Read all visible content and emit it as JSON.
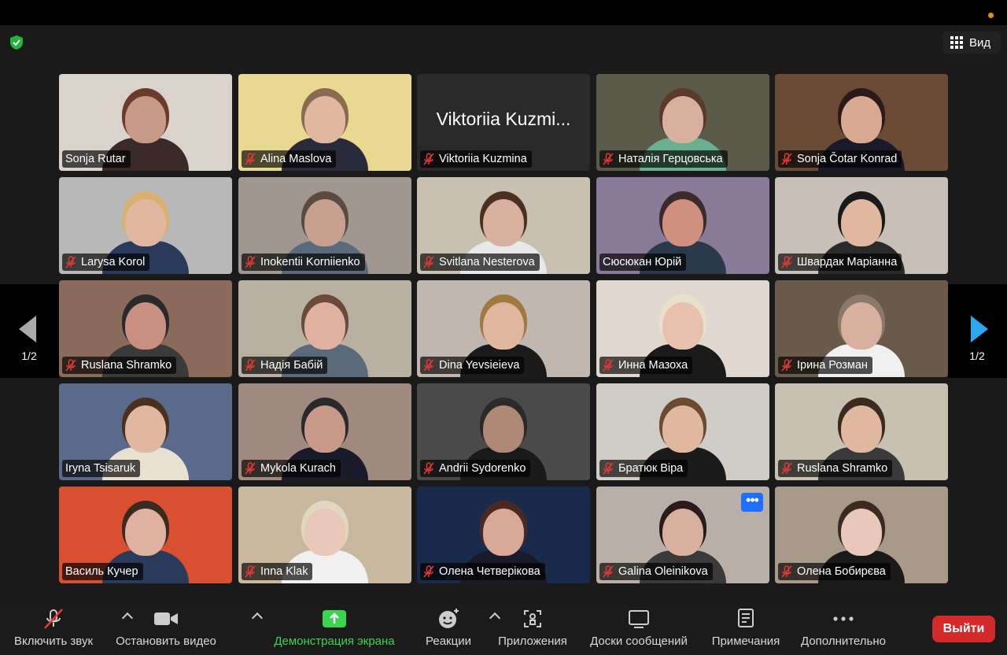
{
  "header": {
    "view_label": "Вид"
  },
  "pagination": {
    "left_page": "1/2",
    "right_page": "1/2"
  },
  "participants": [
    {
      "name": "Sonja Rutar",
      "muted": false,
      "active": true,
      "bg": "#d9d3cc",
      "skin": "#c79a85",
      "hair": "#6b3a2a",
      "shirt": "#3a2a2a"
    },
    {
      "name": "Alina Maslova",
      "muted": true,
      "bg": "#e8d890",
      "skin": "#e0b8a0",
      "hair": "#8a6a50",
      "shirt": "#2a2a3a"
    },
    {
      "name": "Viktoriia Kuzmina",
      "display_name": "Viktoriia Kuzmi...",
      "muted": true,
      "no_video": true
    },
    {
      "name": "Наталія Герцовська",
      "muted": true,
      "bg": "#5a5a4a",
      "skin": "#d8b0a0",
      "hair": "#5a3a2a",
      "shirt": "#6ab090"
    },
    {
      "name": "Sonja Čotar Konrad",
      "muted": true,
      "bg": "#6b4a35",
      "skin": "#d8a890",
      "hair": "#2a1a1a",
      "shirt": "#1a1a2a"
    },
    {
      "name": "Larysa Korol",
      "muted": true,
      "bg": "#b8b8b8",
      "skin": "#e0b8a0",
      "hair": "#d8b070",
      "shirt": "#2a3a5a"
    },
    {
      "name": "Inokentii Korniienko",
      "muted": true,
      "bg": "#a09890",
      "skin": "#c8a090",
      "hair": "#5a4a40",
      "shirt": "#5a6a7a"
    },
    {
      "name": "Svitlana Nesterova",
      "muted": true,
      "bg": "#c8c0b0",
      "skin": "#d8b0a0",
      "hair": "#4a3020",
      "shirt": "#e8e8e8"
    },
    {
      "name": "Сюсюкан Юрій",
      "muted": false,
      "bg": "#8a7a9a",
      "skin": "#d09080",
      "hair": "#3a2a2a",
      "shirt": "#2a3a4a"
    },
    {
      "name": "Швардак Маріанна",
      "muted": true,
      "bg": "#c8c0b8",
      "skin": "#e0b8a0",
      "hair": "#1a1a1a",
      "shirt": "#2a2a2a"
    },
    {
      "name": "Ruslana Shramko",
      "muted": true,
      "bg": "#8a6a5a",
      "skin": "#c89080",
      "hair": "#2a2a2a",
      "shirt": "#3a3a3a"
    },
    {
      "name": "Надія Бабій",
      "muted": true,
      "bg": "#b8b0a0",
      "skin": "#e0b0a0",
      "hair": "#6a4a3a",
      "shirt": "#5a6a7a"
    },
    {
      "name": "Dina Yevsieieva",
      "muted": true,
      "bg": "#c0b8b0",
      "skin": "#e0b8a0",
      "hair": "#a07a40",
      "shirt": "#1a1a1a"
    },
    {
      "name": "Инна Мазоха",
      "muted": true,
      "bg": "#e0d8d0",
      "skin": "#e8c0b0",
      "hair": "#e8e0c8",
      "shirt": "#1a1a1a"
    },
    {
      "name": "Ірина  Розман",
      "muted": true,
      "bg": "#6a5a4a",
      "skin": "#d8b0a0",
      "hair": "#8a7a6a",
      "shirt": "#f0f0f0"
    },
    {
      "name": "Iryna Tsisaruk",
      "muted": false,
      "bg": "#5a6a8a",
      "skin": "#e0b8a0",
      "hair": "#4a3020",
      "shirt": "#e8e0d0"
    },
    {
      "name": "Mykola Kurach",
      "muted": true,
      "bg": "#a08a80",
      "skin": "#c89888",
      "hair": "#2a2a2a",
      "shirt": "#1a1a2a"
    },
    {
      "name": "Andrii Sydorenko",
      "muted": true,
      "bg": "#4a4a4a",
      "skin": "#b08878",
      "hair": "#2a2a2a",
      "shirt": "#1a1a1a"
    },
    {
      "name": "Братюк Віра",
      "muted": true,
      "bg": "#d0ccc8",
      "skin": "#e0b8a0",
      "hair": "#6a4a30",
      "shirt": "#1a1a1a"
    },
    {
      "name": "Ruslana Shramko",
      "muted": true,
      "bg": "#c8c0b0",
      "skin": "#e0b8a0",
      "hair": "#3a2a20",
      "shirt": "#3a3a3a"
    },
    {
      "name": "Василь Кучер",
      "muted": false,
      "bg": "#d85030",
      "skin": "#e0b0a0",
      "hair": "#3a2a20",
      "shirt": "#2a3a5a"
    },
    {
      "name": "Inna Klak",
      "muted": true,
      "bg": "#c8b8a0",
      "skin": "#e8c8b8",
      "hair": "#e0d8c0",
      "shirt": "#f0f0f0"
    },
    {
      "name": "Олена Четверікова",
      "muted": true,
      "bg": "#1a2a4a",
      "skin": "#d8a898",
      "hair": "#4a2a20",
      "shirt": "#1a1a2a"
    },
    {
      "name": "Galina Oleinikova",
      "muted": true,
      "bg": "#b8b0a8",
      "skin": "#d8b0a0",
      "hair": "#2a1a1a",
      "shirt": "#3a3a3a",
      "more_button": true,
      "more_label": "•••"
    },
    {
      "name": "Олена Бобирєва",
      "muted": true,
      "bg": "#a89a88",
      "skin": "#e8c8b8",
      "hair": "#3a2a20",
      "shirt": "#1a1a1a"
    }
  ],
  "toolbar": {
    "unmute": "Включить звук",
    "stop_video": "Остановить видео",
    "share_screen": "Демонстрация экрана",
    "reactions": "Реакции",
    "apps": "Приложения",
    "whiteboards": "Доски сообщений",
    "notes": "Примечания",
    "more": "Дополнительно",
    "leave": "Выйти"
  },
  "colors": {
    "active_speaker": "#3bd34f",
    "leave_button": "#d42a2a",
    "share_accent": "#3bd34f",
    "more_button": "#1e6fff"
  }
}
